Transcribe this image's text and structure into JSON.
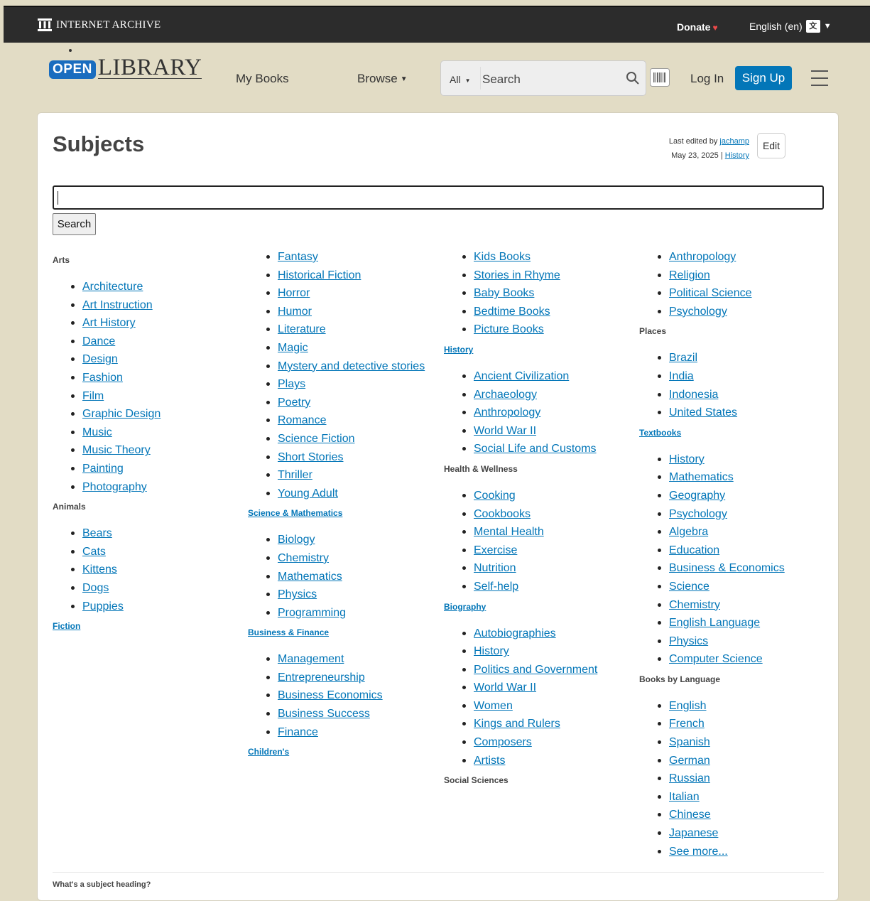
{
  "topbar": {
    "logo_text": "INTERNET ARCHIVE",
    "donate": "Donate",
    "language": "English (en)"
  },
  "header": {
    "logo_open": "OPEN",
    "logo_library": "LIBRARY",
    "my_books": "My Books",
    "browse": "Browse",
    "search_scope": "All",
    "search_placeholder": "Search",
    "login": "Log In",
    "signup": "Sign Up"
  },
  "page": {
    "title": "Subjects",
    "edited_prefix": "Last edited by",
    "edited_user": "jachamp",
    "edited_date": "May 23, 2025 |",
    "history_link": "History",
    "edit_button": "Edit",
    "search_button": "Search",
    "footer_question": "What's a subject heading?"
  },
  "columns": [
    {
      "blocks": [
        {
          "heading": "Arts",
          "heading_link": false,
          "items": [
            "Architecture",
            "Art Instruction",
            "Art History",
            "Dance",
            "Design",
            "Fashion",
            "Film",
            "Graphic Design",
            "Music",
            "Music Theory",
            "Painting",
            "Photography"
          ]
        },
        {
          "heading": "Animals",
          "heading_link": false,
          "items": [
            "Bears",
            "Cats",
            "Kittens",
            "Dogs",
            "Puppies"
          ]
        },
        {
          "heading": "Fiction",
          "heading_link": true,
          "items": []
        }
      ]
    },
    {
      "blocks": [
        {
          "heading": "",
          "heading_link": false,
          "items": [
            "Fantasy",
            "Historical Fiction",
            "Horror",
            "Humor",
            "Literature",
            "Magic",
            "Mystery and detective stories",
            "Plays",
            "Poetry",
            "Romance",
            "Science Fiction",
            "Short Stories",
            "Thriller",
            "Young Adult"
          ]
        },
        {
          "heading": "Science & Mathematics",
          "heading_link": true,
          "items": [
            "Biology",
            "Chemistry",
            "Mathematics",
            "Physics",
            "Programming"
          ]
        },
        {
          "heading": "Business & Finance",
          "heading_link": true,
          "items": [
            "Management",
            "Entrepreneurship",
            "Business Economics",
            "Business Success",
            "Finance"
          ]
        },
        {
          "heading": "Children's",
          "heading_link": true,
          "items": []
        }
      ]
    },
    {
      "blocks": [
        {
          "heading": "",
          "heading_link": false,
          "items": [
            "Kids Books",
            "Stories in Rhyme",
            "Baby Books",
            "Bedtime Books",
            "Picture Books"
          ]
        },
        {
          "heading": "History",
          "heading_link": true,
          "items": [
            "Ancient Civilization",
            "Archaeology",
            "Anthropology",
            "World War II",
            "Social Life and Customs"
          ]
        },
        {
          "heading": "Health & Wellness",
          "heading_link": false,
          "items": [
            "Cooking",
            "Cookbooks",
            "Mental Health",
            "Exercise",
            "Nutrition",
            "Self-help"
          ]
        },
        {
          "heading": "Biography",
          "heading_link": true,
          "items": [
            "Autobiographies",
            "History",
            "Politics and Government",
            "World War II",
            "Women",
            "Kings and Rulers",
            "Composers",
            "Artists"
          ]
        },
        {
          "heading": "Social Sciences",
          "heading_link": false,
          "items": []
        }
      ]
    },
    {
      "blocks": [
        {
          "heading": "",
          "heading_link": false,
          "items": [
            "Anthropology",
            "Religion",
            "Political Science",
            "Psychology"
          ]
        },
        {
          "heading": "Places",
          "heading_link": false,
          "items": [
            "Brazil",
            "India",
            "Indonesia",
            "United States"
          ]
        },
        {
          "heading": "Textbooks",
          "heading_link": true,
          "items": [
            "History",
            "Mathematics",
            "Geography",
            "Psychology",
            "Algebra",
            "Education",
            "Business & Economics",
            "Science",
            "Chemistry",
            "English Language",
            "Physics",
            "Computer Science"
          ]
        },
        {
          "heading": "Books by Language",
          "heading_link": false,
          "items": [
            "English",
            "French",
            "Spanish",
            "German",
            "Russian",
            "Italian",
            "Chinese",
            "Japanese",
            "See more..."
          ]
        }
      ]
    }
  ]
}
